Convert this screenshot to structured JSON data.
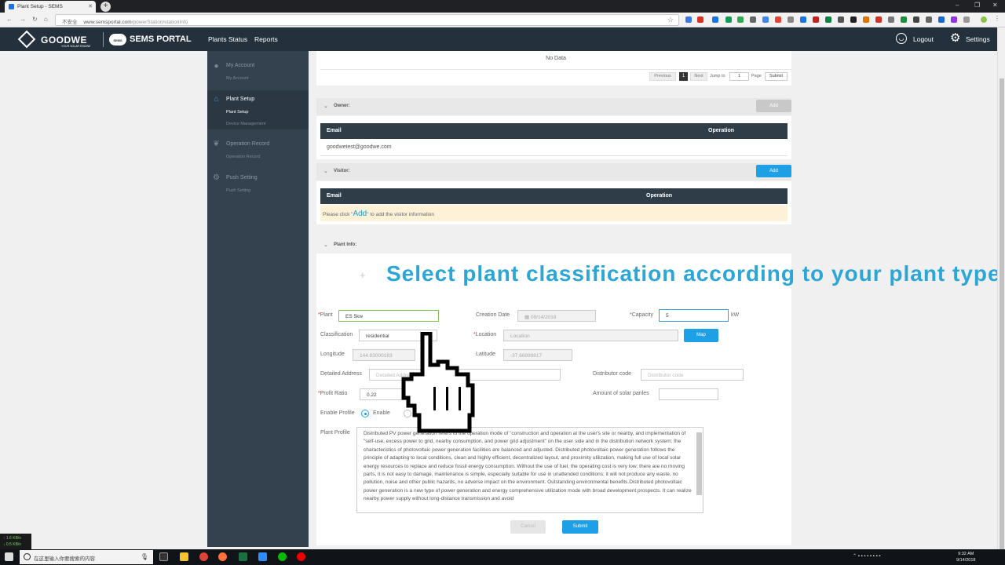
{
  "browser": {
    "tab_title": "Plant Setup - SEMS",
    "new_tab": "+",
    "insecure_label": "不安全",
    "url_host": "www.semsportal.com",
    "url_path": "/powerStation/stationInfo"
  },
  "header": {
    "brand": "GOODWE",
    "brand_tagline": "YOUR SOLAR ENGINE",
    "portal_badge": "SEMS",
    "portal": "SEMS PORTAL",
    "nav": [
      "Plants Status",
      "Reports"
    ],
    "logout": "Logout",
    "settings": "Settings"
  },
  "sidebar": {
    "groups": [
      {
        "title": "My Account",
        "items": [
          "My Account"
        ]
      },
      {
        "title": "Plant Setup",
        "items": [
          "Plant Setup",
          "Device Management"
        ]
      },
      {
        "title": "Operation Record",
        "items": [
          "Operation Record"
        ]
      },
      {
        "title": "Push Setting",
        "items": [
          "Push Setting"
        ]
      }
    ]
  },
  "device_table": {
    "empty_text": "No Data",
    "pager": {
      "previous": "Previous",
      "current": "1",
      "next": "Next",
      "jump_to": "Jump to",
      "page_input": "1",
      "page_label": "Page",
      "submit": "Submit"
    }
  },
  "owner": {
    "section_label": "Owner:",
    "add": "Add",
    "headers": [
      "Email",
      "Operation"
    ],
    "rows": [
      {
        "email": "goodwetest@goodwe.com"
      }
    ]
  },
  "visitor": {
    "section_label": "Visitor:",
    "add": "Add",
    "headers": [
      "Email",
      "Operation"
    ],
    "hint_before": "Please click \"",
    "hint_link": "Add",
    "hint_after": "\" to add the visitor information"
  },
  "plant_info": {
    "section_label": "Plant Info:",
    "overlay_caption": "Select plant classification according to your plant type",
    "fields": {
      "plant": {
        "label": "Plant",
        "value": "ES 5kw"
      },
      "creation_date": {
        "label": "Creation Date",
        "value": "09/14/2018"
      },
      "capacity": {
        "label": "Capacity",
        "value": "5",
        "unit": "kW"
      },
      "classification": {
        "label": "Classification",
        "value": "residential"
      },
      "location": {
        "label": "Location",
        "placeholder": "Location",
        "button": "Map"
      },
      "longitude": {
        "label": "Longitude",
        "value": "144.83000183"
      },
      "latitude": {
        "label": "Latitude",
        "value": "-37.66999817"
      },
      "detailed_address": {
        "label": "Detailed Address",
        "placeholder": "Detailed Address"
      },
      "distributor_code": {
        "label": "Distributor code",
        "placeholder": "Distributor code"
      },
      "profit_ratio": {
        "label": "Profit Ratio",
        "value": "0.22"
      },
      "solar_panels": {
        "label": "Amount of solar panles",
        "value": ""
      },
      "enable_profile": {
        "label": "Enable Profile",
        "option": "Enable"
      },
      "plant_profile": {
        "label": "Plant Profile",
        "text": "Distributed PV power generation refers to the operation mode of \"construction and operation at the user's site or nearby, and implementation of \"self-use, excess power to grid, nearby consumption, and power grid adjustment\" on the user side and in the distribution network system; the characteristics of photovoltaic power generation facilities are balanced and adjusted. Distributed photovoltaic power generation follows the principle of adapting to local conditions, clean and highly efficient, decentralized layout, and proximity utilization, making full use of local solar energy resources to replace and reduce fossil energy consumption. Without the use of fuel, the operating cost is very low; there are no moving parts, it is not easy to damage, maintenance is simple, especially suitable for use in unattended conditions; it will not produce any waste, no pollution, noise and other public hazards, no adverse impact on the environment. Outstanding environmental benefits.Distributed photovoltaic power generation is a new type of power generation and energy comprehensive utilization mode with broad development prospects. It can realize nearby power supply without long-distance transmission and avoid"
      }
    },
    "cancel": "Cancel",
    "submit": "Submit"
  },
  "netmeter": {
    "up": "↑ 1.6 KB/s",
    "down": "↓ 0.5 KB/s"
  },
  "taskbar": {
    "search_placeholder": "在这里输入你要搜索的内容",
    "time": "9:32 AM",
    "date": "9/14/2018"
  },
  "colors": {
    "accent": "#1ea0e6",
    "header_bg": "#24313d",
    "sidebar_bg": "#34424f",
    "caption": "#2ba6d7"
  }
}
